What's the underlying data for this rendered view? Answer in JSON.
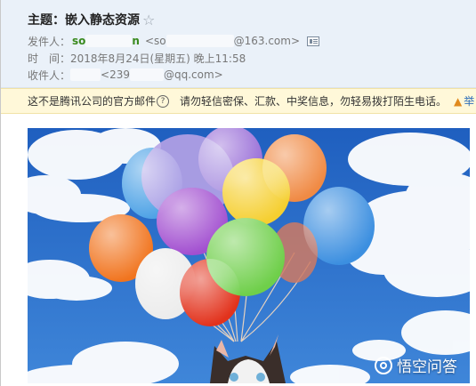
{
  "email": {
    "subject_label": "主题：",
    "subject": "嵌入静态资源",
    "star_glyph": "☆",
    "sender_label": "发件人：",
    "sender_name": "so",
    "sender_name_tail": "n",
    "sender_addr_prefix": "<so",
    "sender_addr_suffix": "@163.com>",
    "time_label": "时　间：",
    "time_value": "2018年8月24日(星期五) 晚上11:58",
    "recipient_label": "收件人：",
    "recipient_addr_prefix": "<239",
    "recipient_addr_suffix": "@qq.com>"
  },
  "warning": {
    "text1": "这不是腾讯公司的官方邮件",
    "help": "?",
    "text2": "请勿轻信密保、汇款、中奖信息，勿轻易拨打陌生电话。",
    "report": "举"
  },
  "watermark": {
    "text": "悟空问答"
  },
  "colors": {
    "header_bg": "#eaf1f9",
    "warning_bg": "#fff8d9",
    "sender_green": "#3a8a1e",
    "sky": "#2f6fc8"
  }
}
